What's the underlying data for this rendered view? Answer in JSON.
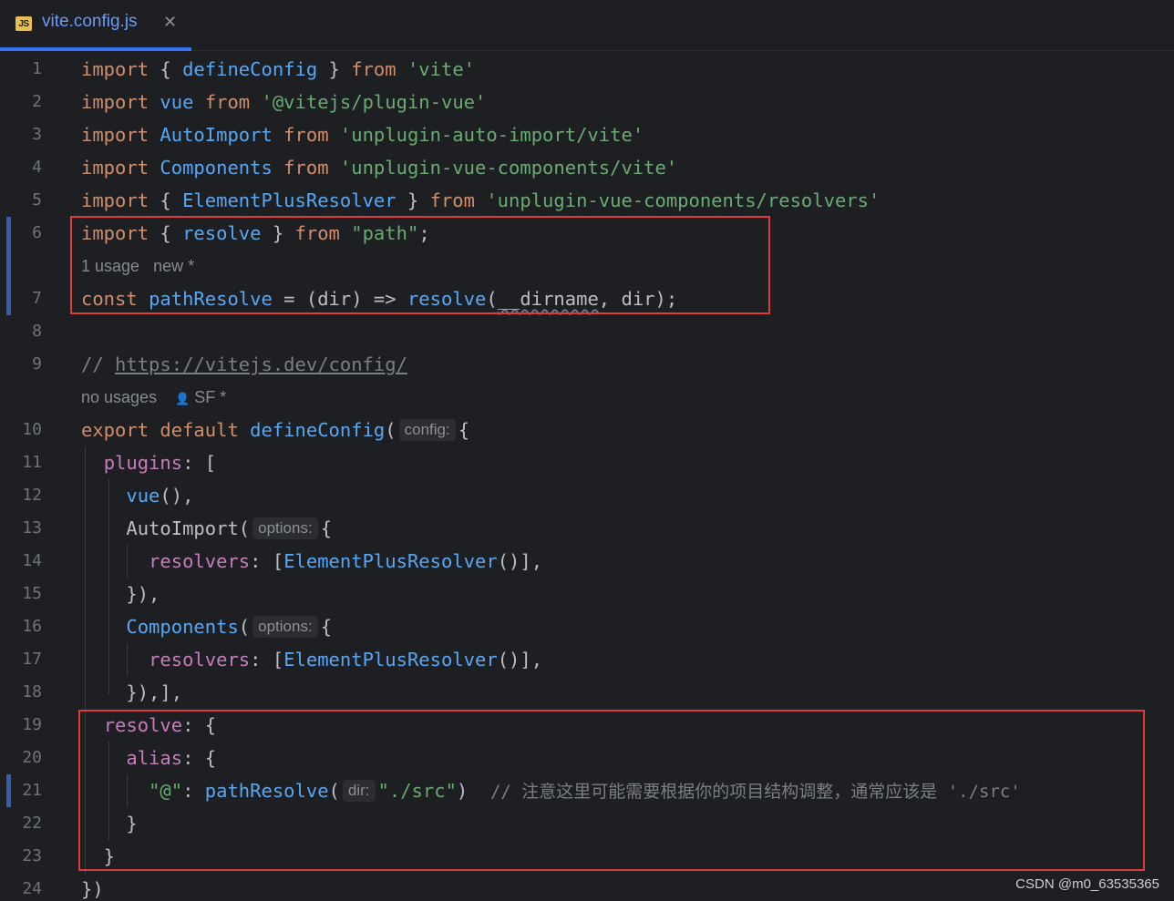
{
  "tab": {
    "icon": "JS",
    "filename": "vite.config.js",
    "close": "✕"
  },
  "lines": {
    "n1": "1",
    "n2": "2",
    "n3": "3",
    "n4": "4",
    "n5": "5",
    "n6": "6",
    "n7": "7",
    "n8": "8",
    "n9": "9",
    "n10": "10",
    "n11": "11",
    "n12": "12",
    "n13": "13",
    "n14": "14",
    "n15": "15",
    "n16": "16",
    "n17": "17",
    "n18": "18",
    "n19": "19",
    "n20": "20",
    "n21": "21",
    "n22": "22",
    "n23": "23",
    "n24": "24"
  },
  "code": {
    "import": "import",
    "from": "from",
    "const": "const",
    "export": "export",
    "default": "default",
    "defineConfig": "defineConfig",
    "vite": "'vite'",
    "vue": "vue",
    "pluginVue": "'@vitejs/plugin-vue'",
    "AutoImport": "AutoImport",
    "autoImportPkg": "'unplugin-auto-import/vite'",
    "Components": "Components",
    "componentsPkg": "'unplugin-vue-components/vite'",
    "ElementPlusResolver": "ElementPlusResolver",
    "resolversPkg": "'unplugin-vue-components/resolvers'",
    "resolve": "resolve",
    "path": "\"path\"",
    "pathResolve": "pathResolve",
    "dir": "dir",
    "dirname": "__dirname",
    "commentSlashes": "// ",
    "url": "https://vitejs.dev/config/",
    "plugins": "plugins",
    "resolvers": "resolvers",
    "alias": "alias",
    "at": "\"@\"",
    "src": "\"./src\"",
    "comment21": "// 注意这里可能需要根据你的项目结构调整，通常应该是 './src'"
  },
  "hints": {
    "usage1": "1 usage",
    "new1": "new *",
    "noUsages": "no usages",
    "author": "SF *",
    "config": "config:",
    "options": "options:",
    "dir": "dir:"
  },
  "watermark": "CSDN @m0_63535365",
  "colors": {
    "highlight_box": "#e03b3b",
    "tab_underline": "#3574f0",
    "keyword": "#cf8e6d",
    "identifier": "#56a8f5",
    "string": "#6aab73",
    "property": "#c77dbb"
  }
}
